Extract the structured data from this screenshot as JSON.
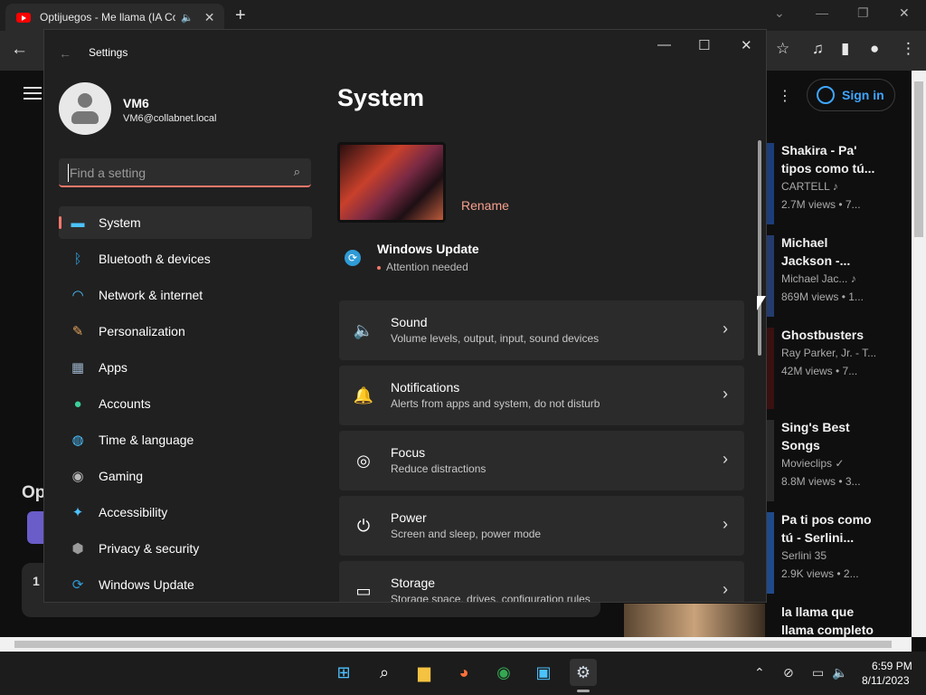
{
  "browser": {
    "tab_title": "Optijuegos - Me llama (IA Co",
    "tab_close": "✕",
    "new_tab": "+",
    "back": "←",
    "win_min": "—",
    "win_restore": "❐",
    "win_close": "✕",
    "chevron": "⌄",
    "star": "☆",
    "media": "♫",
    "sidebar": "▮",
    "profile": "●",
    "menu": "⋮"
  },
  "youtube": {
    "sign_in": "Sign in",
    "op_text": "Op",
    "comment_count": "1",
    "recommended": [
      {
        "title": "Shakira - Pa' tipos como tú...",
        "channel": "CARTELL ♪",
        "meta": "2.7M views • 7..."
      },
      {
        "title": "Michael Jackson -...",
        "channel": "Michael Jac... ♪",
        "meta": "869M views • 1..."
      },
      {
        "title": "Ghostbusters",
        "channel": "Ray Parker, Jr. - T...",
        "meta": "42M views • 7..."
      },
      {
        "title": "Sing's Best Songs",
        "channel": "Movieclips ✓",
        "meta": "8.8M views • 3..."
      },
      {
        "title": "Pa ti pos como tú - Serlini...",
        "channel": "Serlini 35",
        "meta": "2.9K views • 2..."
      },
      {
        "title": "la llama que llama completo",
        "channel": "",
        "meta": ""
      }
    ]
  },
  "settings": {
    "window_title": "Settings",
    "back_arrow": "←",
    "min": "—",
    "max": "☐",
    "close": "✕",
    "user_name": "VM6",
    "user_email": "VM6@collabnet.local",
    "search_placeholder": "Find a setting",
    "search_icon": "⌕",
    "nav": [
      {
        "label": "System",
        "icon": "system-icon",
        "glyph": "▬",
        "color": "#4cc2ff",
        "selected": true
      },
      {
        "label": "Bluetooth & devices",
        "icon": "bluetooth-icon",
        "glyph": "ᛒ",
        "color": "#2f9bd6"
      },
      {
        "label": "Network & internet",
        "icon": "wifi-icon",
        "glyph": "◠",
        "color": "#4cc2ff"
      },
      {
        "label": "Personalization",
        "icon": "brush-icon",
        "glyph": "✎",
        "color": "#e3a35c"
      },
      {
        "label": "Apps",
        "icon": "apps-icon",
        "glyph": "▦",
        "color": "#9ab1c8"
      },
      {
        "label": "Accounts",
        "icon": "accounts-icon",
        "glyph": "●",
        "color": "#3ccf9b"
      },
      {
        "label": "Time & language",
        "icon": "globe-icon",
        "glyph": "◍",
        "color": "#4cc2ff"
      },
      {
        "label": "Gaming",
        "icon": "gamepad-icon",
        "glyph": "◉",
        "color": "#b8b8b8"
      },
      {
        "label": "Accessibility",
        "icon": "accessibility-icon",
        "glyph": "✦",
        "color": "#4cc2ff"
      },
      {
        "label": "Privacy & security",
        "icon": "shield-icon",
        "glyph": "⬢",
        "color": "#9a9a9a"
      },
      {
        "label": "Windows Update",
        "icon": "update-icon",
        "glyph": "⟳",
        "color": "#2f9bd6"
      }
    ],
    "page_title": "System",
    "rename": "Rename",
    "update_title": "Windows Update",
    "update_status": "Attention needed",
    "update_glyph": "⟳",
    "cards": [
      {
        "title": "Sound",
        "desc": "Volume levels, output, input, sound devices",
        "icon": "speaker-icon",
        "glyph": "🔈"
      },
      {
        "title": "Notifications",
        "desc": "Alerts from apps and system, do not disturb",
        "icon": "bell-icon",
        "glyph": "🔔"
      },
      {
        "title": "Focus",
        "desc": "Reduce distractions",
        "icon": "focus-icon",
        "glyph": "◎"
      },
      {
        "title": "Power",
        "desc": "Screen and sleep, power mode",
        "icon": "power-icon",
        "glyph": "⏻"
      },
      {
        "title": "Storage",
        "desc": "Storage space, drives, configuration rules",
        "icon": "storage-icon",
        "glyph": "▭"
      }
    ],
    "chevron": "›"
  },
  "taskbar": {
    "apps": [
      {
        "name": "start-icon",
        "glyph": "⊞",
        "color": "#4cc2ff"
      },
      {
        "name": "search-icon",
        "glyph": "⌕",
        "color": "#ffffff"
      },
      {
        "name": "file-explorer-icon",
        "glyph": "▆",
        "color": "#f5c242"
      },
      {
        "name": "firefox-icon",
        "glyph": "◕",
        "color": "#ff7139"
      },
      {
        "name": "chrome-icon",
        "glyph": "◉",
        "color": "#34a853"
      },
      {
        "name": "store-icon",
        "glyph": "▣",
        "color": "#4cc2ff"
      },
      {
        "name": "settings-icon",
        "glyph": "⚙",
        "color": "#cfd8e3"
      }
    ],
    "tray_chevron": "⌃",
    "tray_network": "⊘",
    "tray_display": "▭",
    "tray_volume": "🔈",
    "time": "6:59 PM",
    "date": "8/11/2023"
  }
}
